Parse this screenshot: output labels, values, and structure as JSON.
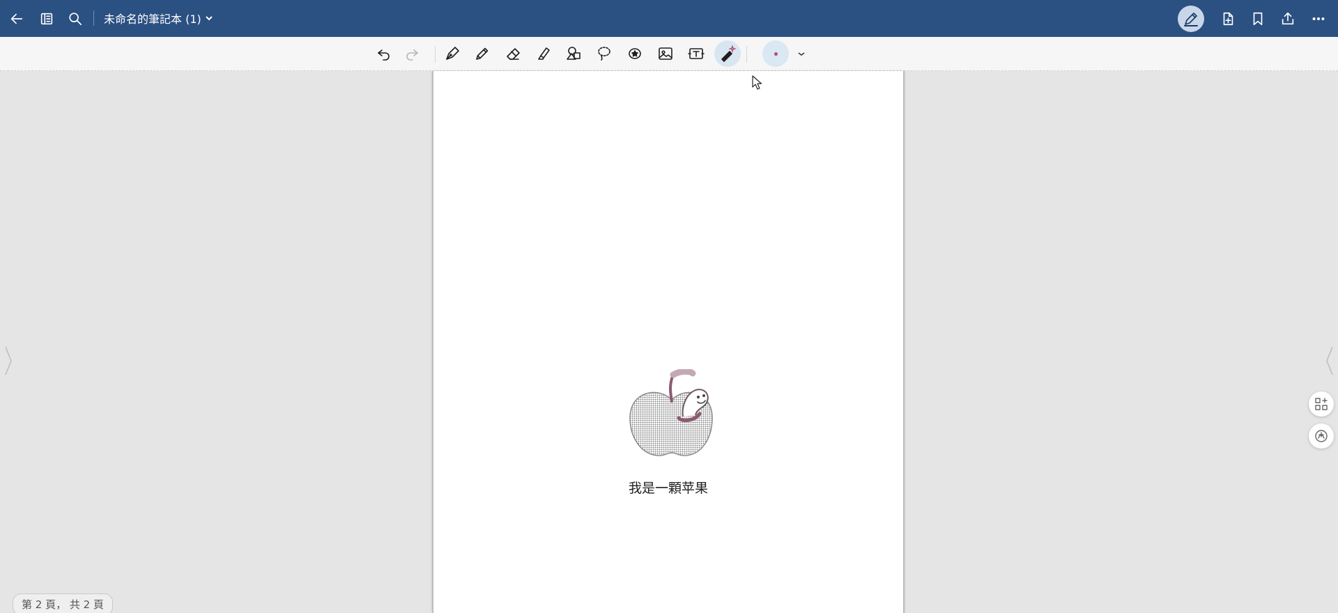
{
  "topbar": {
    "notebook_title": "未命名的筆記本 (1)"
  },
  "toolbar": {
    "tools": [
      "undo",
      "redo",
      "pen",
      "pencil",
      "eraser",
      "highlighter",
      "shapes",
      "lasso",
      "sticker",
      "image",
      "textbox",
      "laser-pointer"
    ],
    "active_tool": "laser-pointer",
    "current_color": "#b84a68"
  },
  "page": {
    "caption": "我是一顆苹果"
  },
  "status": {
    "page_indicator": "第 2 頁， 共 2 頁"
  },
  "colors": {
    "title_bar": "#2b5082",
    "toolbar_bg": "#f6f6f6",
    "canvas_bg": "#e5e5e5",
    "active_tool_bg": "#d8e6f2"
  }
}
